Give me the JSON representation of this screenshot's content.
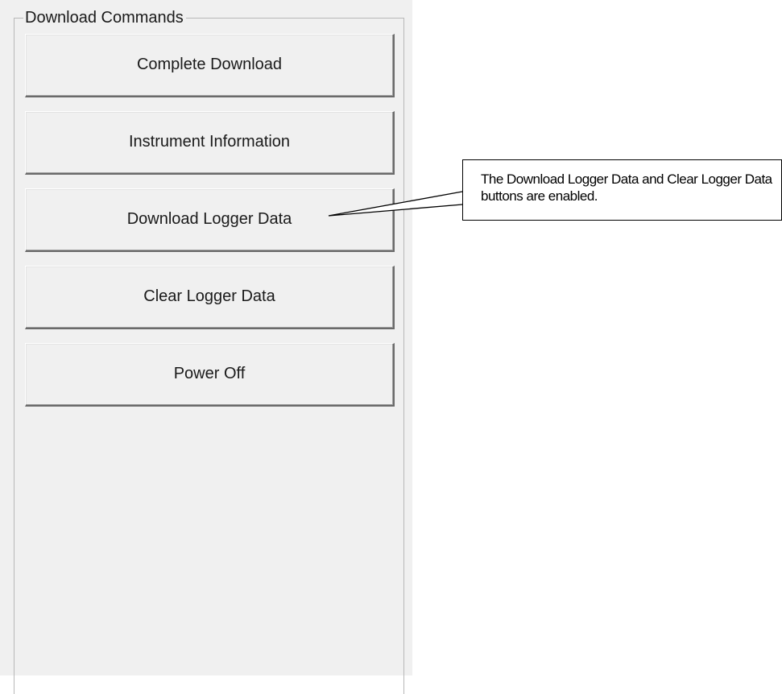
{
  "group": {
    "title": "Download Commands"
  },
  "buttons": [
    {
      "label": "Complete Download"
    },
    {
      "label": "Instrument Information"
    },
    {
      "label": "Download Logger Data"
    },
    {
      "label": "Clear Logger Data"
    },
    {
      "label": "Power Off"
    }
  ],
  "callout": {
    "text": "The Download Logger Data and Clear Logger Data buttons are enabled."
  }
}
